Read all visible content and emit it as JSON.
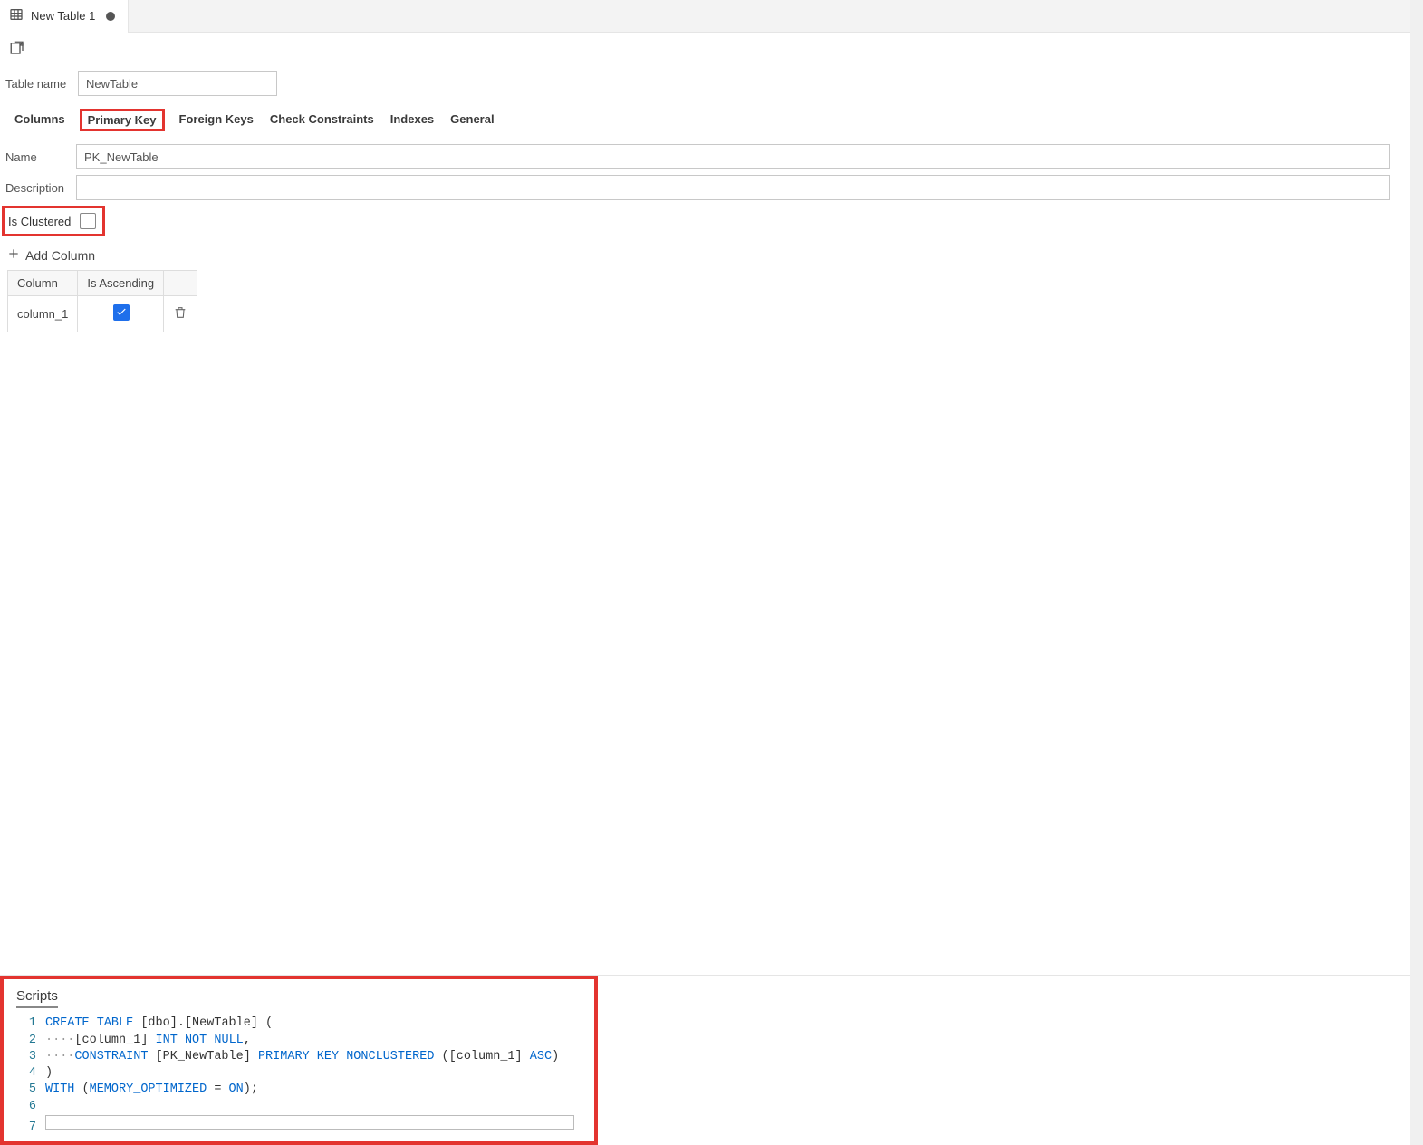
{
  "file_tab": {
    "title": "New Table 1",
    "dirty": true
  },
  "toolbar": {
    "action_icon": "open-new-icon"
  },
  "table_name": {
    "label": "Table name",
    "value": "NewTable"
  },
  "nav_tabs": [
    "Columns",
    "Primary Key",
    "Foreign Keys",
    "Check Constraints",
    "Indexes",
    "General"
  ],
  "active_tab_index": 1,
  "pk": {
    "name_label": "Name",
    "name_value": "PK_NewTable",
    "desc_label": "Description",
    "desc_value": "",
    "cluster_label": "Is Clustered",
    "cluster_checked": false,
    "add_col_label": "Add Column",
    "grid": {
      "headers": [
        "Column",
        "Is Ascending",
        ""
      ],
      "rows": [
        {
          "column": "column_1",
          "ascending": true
        }
      ]
    }
  },
  "scripts": {
    "title": "Scripts",
    "lines": [
      {
        "n": 1,
        "segments": [
          {
            "t": "CREATE",
            "c": "kw"
          },
          {
            "t": " ",
            "c": "pl"
          },
          {
            "t": "TABLE",
            "c": "kw"
          },
          {
            "t": " [dbo].[NewTable] (",
            "c": "pl"
          }
        ]
      },
      {
        "n": 2,
        "segments": [
          {
            "t": "····",
            "c": "gr"
          },
          {
            "t": "[column_1] ",
            "c": "pl"
          },
          {
            "t": "INT",
            "c": "kw"
          },
          {
            "t": " ",
            "c": "pl"
          },
          {
            "t": "NOT",
            "c": "kw"
          },
          {
            "t": " ",
            "c": "pl"
          },
          {
            "t": "NULL",
            "c": "kw"
          },
          {
            "t": ",",
            "c": "pl"
          }
        ]
      },
      {
        "n": 3,
        "segments": [
          {
            "t": "····",
            "c": "gr"
          },
          {
            "t": "CONSTRAINT",
            "c": "kw"
          },
          {
            "t": " [PK_NewTable] ",
            "c": "pl"
          },
          {
            "t": "PRIMARY",
            "c": "kw"
          },
          {
            "t": " ",
            "c": "pl"
          },
          {
            "t": "KEY",
            "c": "kw"
          },
          {
            "t": " ",
            "c": "pl"
          },
          {
            "t": "NONCLUSTERED",
            "c": "kw"
          },
          {
            "t": " ([column_1] ",
            "c": "pl"
          },
          {
            "t": "ASC",
            "c": "kw"
          },
          {
            "t": ")",
            "c": "pl"
          }
        ]
      },
      {
        "n": 4,
        "segments": [
          {
            "t": ")",
            "c": "pl"
          }
        ]
      },
      {
        "n": 5,
        "segments": [
          {
            "t": "WITH",
            "c": "kw"
          },
          {
            "t": " (",
            "c": "pl"
          },
          {
            "t": "MEMORY_OPTIMIZED",
            "c": "kw"
          },
          {
            "t": " = ",
            "c": "pl"
          },
          {
            "t": "ON",
            "c": "kw"
          },
          {
            "t": ");",
            "c": "pl"
          }
        ]
      },
      {
        "n": 6,
        "segments": []
      },
      {
        "n": 7,
        "segments": [],
        "cursor": true
      }
    ]
  }
}
